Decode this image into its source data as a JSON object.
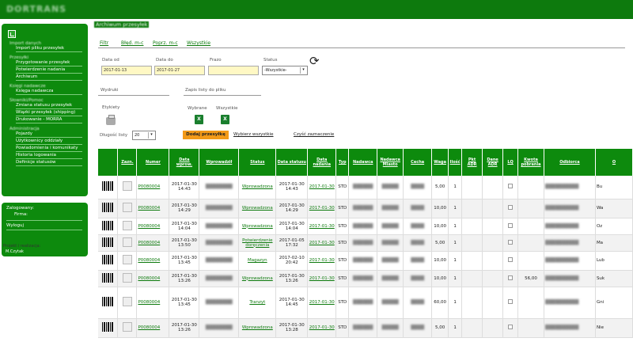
{
  "header": {
    "logo": "DORTRANS"
  },
  "sidebar": {
    "groups": [
      {
        "title": "Import danych",
        "items": [
          "Import pliku przesyłek"
        ]
      },
      {
        "title": "Przesyłki",
        "items": [
          "Przygotowanie przesyłek",
          "Potwierdzenie nadania",
          "Archiwum"
        ]
      },
      {
        "title": "Księgi nadawcze",
        "items": [
          "Księga nadawcza"
        ]
      },
      {
        "title": "Słowniki/Pomoc",
        "items": [
          "Zmiana statusu przesyłek",
          "Wiązki przesyłek (shipping)",
          "Drukowanie - MORRA"
        ]
      },
      {
        "title": "Administracja",
        "items": [
          "Pojazdy",
          "Użytkownicy oddziały",
          "Powiadomienia i komunikaty",
          "Historia logowania",
          "Definicje statusów"
        ]
      }
    ],
    "user_label": "Zalogowany:",
    "firm_label": "Firma:",
    "logout": "Wyloguj",
    "footer_note": "Projekt i realizacja:",
    "footer_badge": "M.Czytak"
  },
  "main": {
    "title": "Archiwum przesyłek",
    "filters": {
      "label": "Filtr",
      "links": [
        "Błęd. m-c",
        "Poprz. m-c",
        "Wszystkie"
      ]
    },
    "search": {
      "date_from_label": "Data od",
      "date_from": "2017-01-13",
      "date_to_label": "Data do",
      "date_to": "2017-01-27",
      "find_label": "Frazo",
      "status_label": "Status",
      "status_value": "-Wszystkie-"
    },
    "print_label": "Wydruki",
    "save_label": "Zapis listy do pliku",
    "labels_label": "Etykiety",
    "chosen_label": "Wybrane",
    "all_label": "Wszystkie",
    "list_length_label": "Długość listy",
    "list_length": "20",
    "add_button": "Dodaj przesyłkę",
    "select_all": "Wybierz wszystkie",
    "clear_selection": "Czyść zaznaczenie"
  },
  "table": {
    "headers": [
      "",
      "Zazn.",
      "Numer",
      "Data wprow.",
      "Wprowadził",
      "Status",
      "Data statusu",
      "Data nadania",
      "Typ",
      "Nadawca",
      "Nadawca Miasto",
      "Cecha",
      "Waga",
      "Ilość",
      "Pkt ADR",
      "Dane ADR",
      "LQ",
      "Kwota pobrania",
      "Odbiorca",
      "O"
    ],
    "rows": [
      {
        "numer": "P0080004",
        "data_wprow": "2017-01-30 14:43",
        "status": "Wprowadzona",
        "data_statusu": "2017-01-30 14:43",
        "data_nadania": "2017-01-30",
        "typ": "STD",
        "waga": "5,00",
        "ilosc": "1",
        "kwota": "",
        "o": "Bu"
      },
      {
        "numer": "P0080004",
        "data_wprow": "2017-01-30 14:29",
        "status": "Wprowadzona",
        "data_statusu": "2017-01-30 14:29",
        "data_nadania": "2017-01-30",
        "typ": "STD",
        "waga": "10,00",
        "ilosc": "1",
        "kwota": "",
        "o": "Wa"
      },
      {
        "numer": "P0080004",
        "data_wprow": "2017-01-30 14:04",
        "status": "Wprowadzona",
        "data_statusu": "2017-01-30 14:04",
        "data_nadania": "2017-01-30",
        "typ": "STD",
        "waga": "10,00",
        "ilosc": "1",
        "kwota": "",
        "o": "Oz"
      },
      {
        "numer": "P0080004",
        "data_wprow": "2017-01-30 13:50",
        "status": "Potwierdzenie doręczenia",
        "data_statusu": "2017-01-05 17:32",
        "data_nadania": "2017-01-30",
        "typ": "STD",
        "waga": "5,00",
        "ilosc": "1",
        "kwota": "",
        "o": "Ma"
      },
      {
        "numer": "P0080004",
        "data_wprow": "2017-01-30 13:45",
        "status": "Magazyn",
        "data_statusu": "2017-02-10 20:42",
        "data_nadania": "2017-01-30",
        "typ": "STD",
        "waga": "10,00",
        "ilosc": "1",
        "kwota": "",
        "o": "Lub"
      },
      {
        "numer": "P0080004",
        "data_wprow": "2017-01-30 13:26",
        "status": "Wprowadzona",
        "data_statusu": "2017-01-30 13:26",
        "data_nadania": "2017-01-30",
        "typ": "STD",
        "waga": "10,00",
        "ilosc": "1",
        "kwota": "56,00",
        "o": "Suk"
      },
      {
        "numer": "P0080004",
        "data_wprow": "2017-01-30 13:45",
        "status": "Tranzyt",
        "data_statusu": "2017-01-30 14:45",
        "data_nadania": "2017-01-30",
        "typ": "STD",
        "waga": "60,00",
        "ilosc": "1",
        "kwota": "",
        "o": "Gni"
      },
      {
        "numer": "P0080004",
        "data_wprow": "2017-01-30 13:26",
        "status": "Wprowadzona",
        "data_statusu": "2017-01-30 13:28",
        "data_nadania": "2017-01-30",
        "typ": "STD",
        "waga": "5,00",
        "ilosc": "1",
        "kwota": "",
        "o": "Nie"
      }
    ]
  }
}
